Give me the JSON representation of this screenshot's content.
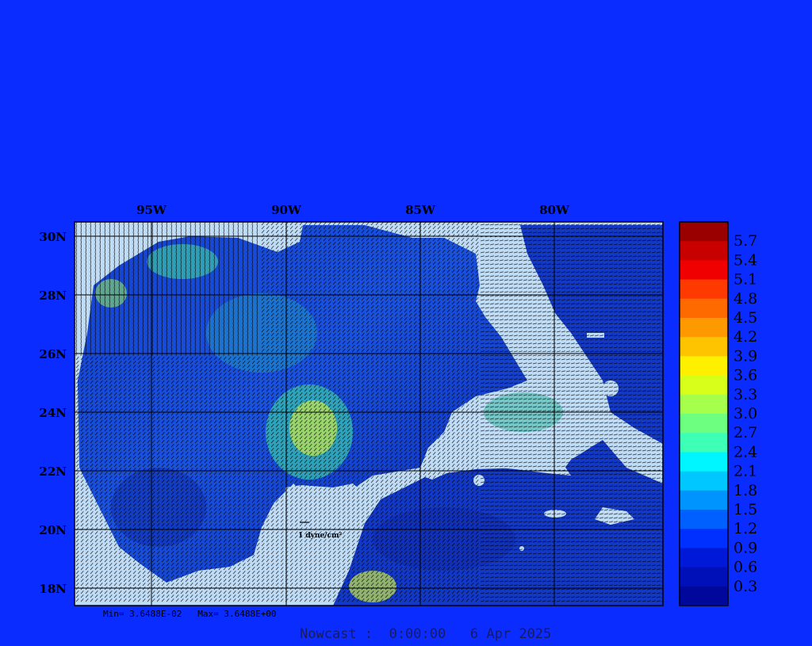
{
  "map": {
    "lon_ticks": [
      "95W",
      "90W",
      "85W",
      "80W"
    ],
    "lat_ticks": [
      "30N",
      "28N",
      "26N",
      "24N",
      "22N",
      "20N",
      "18N"
    ],
    "scale_label": "1 dyne/cm²",
    "land_color": "#bfdcf7",
    "gridline_color": "#000000"
  },
  "colorbar": {
    "labels": [
      "5.7",
      "5.4",
      "5.1",
      "4.8",
      "4.5",
      "4.2",
      "3.9",
      "3.6",
      "3.3",
      "3.0",
      "2.7",
      "2.4",
      "2.1",
      "1.8",
      "1.5",
      "1.2",
      "0.9",
      "0.6",
      "0.3"
    ],
    "colors": [
      "#9b0000",
      "#c80000",
      "#f00000",
      "#ff3a00",
      "#ff6a00",
      "#ff9900",
      "#ffc400",
      "#fff000",
      "#d8ff1a",
      "#a6ff4a",
      "#6cff80",
      "#3dffb5",
      "#00f6ff",
      "#00c7ff",
      "#0094ff",
      "#0060ff",
      "#0030ff",
      "#0018d8",
      "#0010b8",
      "#00089c"
    ]
  },
  "stats": {
    "min_text": "Min= 3.6488E-02",
    "max_text": "Max= 3.6488E+00"
  },
  "footer": {
    "text": "Nowcast :  0:00:00   6 Apr 2025"
  }
}
